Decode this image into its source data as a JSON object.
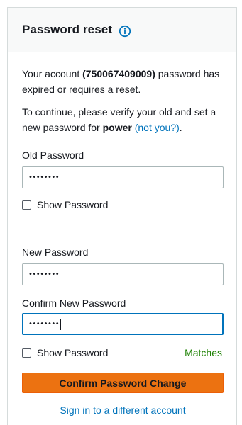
{
  "header": {
    "title": "Password reset",
    "info_icon": "info-circle-icon"
  },
  "intro": {
    "line1_prefix": "Your account ",
    "account_id": "(750067409009)",
    "line1_suffix": " password has expired or requires a reset.",
    "line2_prefix": "To continue, please verify your old and set a new password for ",
    "username": "power",
    "not_you_link": "(not you?)",
    "line2_suffix": "."
  },
  "old_password": {
    "label": "Old Password",
    "value": "••••••••"
  },
  "show_password_1": "Show Password",
  "new_password": {
    "label": "New Password",
    "value": "••••••••"
  },
  "confirm_password": {
    "label": "Confirm New Password",
    "value": "••••••••"
  },
  "show_password_2": "Show Password",
  "match_status": "Matches",
  "confirm_button": "Confirm Password Change",
  "different_account_link": "Sign in to a different account",
  "colors": {
    "accent": "#0073bb",
    "primary_button": "#ec7211",
    "success": "#1d8102"
  }
}
